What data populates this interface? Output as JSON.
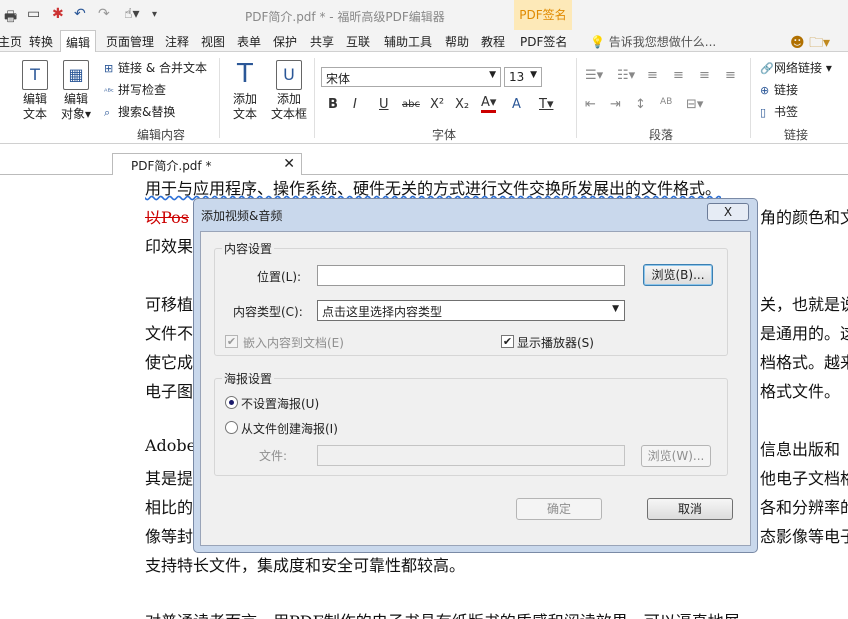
{
  "window": {
    "title": "PDF简介.pdf * - 福昕高级PDF编辑器",
    "context_tab": "PDF签名"
  },
  "menu": {
    "tabs": [
      "主页",
      "转换",
      "编辑",
      "页面管理",
      "注释",
      "视图",
      "表单",
      "保护",
      "共享",
      "互联",
      "辅助工具",
      "帮助",
      "教程",
      "PDF签名"
    ],
    "active": "编辑",
    "tell_me": "告诉我您想做什么..."
  },
  "ribbon": {
    "edit_text": "编辑\n文本",
    "edit_text_1": "编辑",
    "edit_text_2": "文本",
    "edit_obj_1": "编辑",
    "edit_obj_2": "对象",
    "link_merge": "链接 & 合并文本",
    "spell_check": "拼写检查",
    "search_replace": "搜索&替换",
    "group_edit_content": "编辑内容",
    "add_text_1": "添加",
    "add_text_2": "文本",
    "add_textbox_1": "添加",
    "add_textbox_2": "文本框",
    "font_name": "宋体",
    "font_size": "13",
    "group_font": "字体",
    "group_paragraph": "段落",
    "web_link": "网络链接",
    "link": "链接",
    "bookmark": "书签",
    "group_link": "链接"
  },
  "doc_tab": {
    "label": "PDF简介.pdf *"
  },
  "document": {
    "line1": "用于与应用程序、操作系统、硬件无关的方式进行文件交换所发展出的文件格式。",
    "line2_left": "以Pos",
    "line2_right": "角的颜色和文",
    "line3_left": "印效果",
    "line4_left": "可移植",
    "line4_right": "关，也就是说",
    "line5_left": "文件不",
    "line5_right": "是通用的。这",
    "line6_left": "使它成",
    "line6_right": "档格式。越来",
    "line7_left": "电子图",
    "line7_right": "格式文件。",
    "line8_left": "Adobe",
    "line8_right": "信息出版和",
    "line9_left": "其是提",
    "line9_right": "他电子文档格",
    "line10_left": "相比的",
    "line10_right": "各和分辨率的",
    "line11_left": "像等封",
    "line11_right": "态影像等电子",
    "line12": "支持特长文件，集成度和安全可靠性都较高。",
    "line13": "对普通读者而言，用PDF制作的电子书具有纸版书的质感和阅读效果，可以逼真地展"
  },
  "dialog": {
    "title": "添加视频&音频",
    "close": "X",
    "content_settings": "内容设置",
    "location_label": "位置(L):",
    "location_value": "",
    "browse_label": "浏览(B)...",
    "content_type_label": "内容类型(C):",
    "content_type_value": "点击这里选择内容类型",
    "embed_label": "嵌入内容到文档(E)",
    "embed_checked": true,
    "show_player_label": "显示播放器(S)",
    "show_player_checked": true,
    "poster_settings": "海报设置",
    "no_poster_label": "不设置海报(U)",
    "from_file_label": "从文件创建海报(I)",
    "file_label": "文件:",
    "file_value": "",
    "browse2_label": "浏览(W)...",
    "ok_label": "确定",
    "cancel_label": "取消"
  }
}
